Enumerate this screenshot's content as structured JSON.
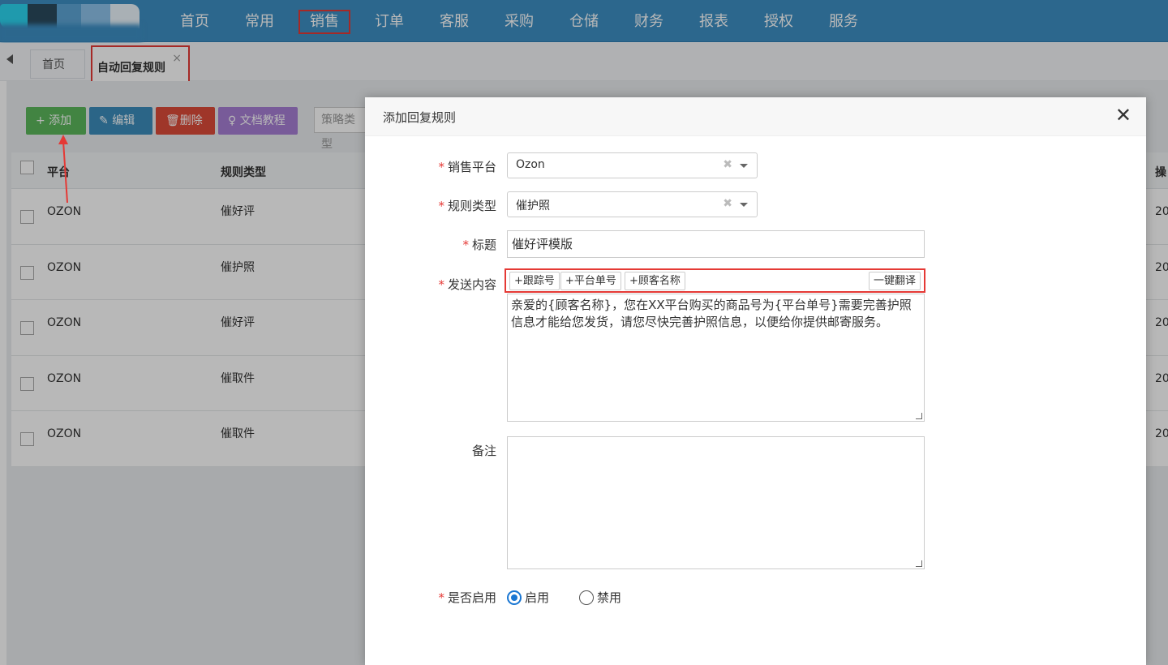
{
  "nav": {
    "items": [
      "首页",
      "常用",
      "销售",
      "订单",
      "客服",
      "采购",
      "仓储",
      "财务",
      "报表",
      "授权",
      "服务"
    ]
  },
  "tabs": {
    "home": "首页",
    "active": "自动回复规则",
    "close": "×"
  },
  "toolbar": {
    "add": "+ 添加",
    "edit": "编辑",
    "delete": "删除",
    "doc": "文档教程",
    "strategy_placeholder": "策略类型"
  },
  "grid": {
    "headers": {
      "platform": "平台",
      "type": "规则类型",
      "op": "操"
    },
    "rows": [
      {
        "platform": "OZON",
        "type": "催好评",
        "op": "20"
      },
      {
        "platform": "OZON",
        "type": "催护照",
        "op": "20"
      },
      {
        "platform": "OZON",
        "type": "催好评",
        "op": "20"
      },
      {
        "platform": "OZON",
        "type": "催取件",
        "op": "20"
      },
      {
        "platform": "OZON",
        "type": "催取件",
        "op": "20"
      }
    ]
  },
  "modal": {
    "title": "添加回复规则",
    "close": "✕",
    "fields": {
      "platform_label": "销售平台",
      "platform_value": "Ozon",
      "type_label": "规则类型",
      "type_value": "催护照",
      "title_label": "标题",
      "title_value": "催好评模版",
      "content_label": "发送内容",
      "content_value": "亲爱的{顾客名称}，您在XX平台购买的商品号为{平台单号}需要完善护照信息才能给您发货，请您尽快完善护照信息，以便给你提供邮寄服务。",
      "remark_label": "备注",
      "remark_value": "",
      "enable_label": "是否启用",
      "enable_on": "启用",
      "enable_off": "禁用"
    },
    "tags": {
      "tracking": "+跟踪号",
      "order_no": "+平台单号",
      "customer": "+顾客名称",
      "translate": "一键翻译"
    }
  },
  "colors": {
    "nav_bg": "#3d8fc4",
    "highlight": "#e53935",
    "btn_add": "#5cb85c",
    "btn_edit": "#3c8dbc",
    "btn_del": "#dd4b39",
    "btn_doc": "#a77fd4",
    "radio_on": "#1976d2"
  }
}
